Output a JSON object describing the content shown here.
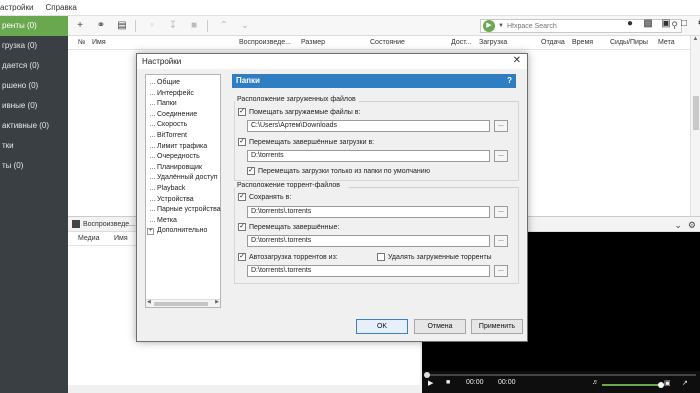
{
  "menubar": {
    "items": [
      "астройки",
      "Справка"
    ]
  },
  "sidebar": {
    "items": [
      {
        "label": "ренты (0)",
        "active": true
      },
      {
        "label": "грузка (0)",
        "active": false
      },
      {
        "label": "дается (0)",
        "active": false
      },
      {
        "label": "ршено (0)",
        "active": false
      },
      {
        "label": "ивные (0)",
        "active": false
      },
      {
        "label": "активные (0)",
        "active": false
      },
      {
        "label": "тки",
        "active": false
      },
      {
        "label": "ты (0)",
        "active": false
      }
    ]
  },
  "toolbar": {
    "search_placeholder": "Hfxpace Search"
  },
  "columns": [
    "№",
    "Имя",
    "Воспроизведе...",
    "Размер",
    "Состояние",
    "Дост...",
    "Загрузка",
    "Отдача",
    "Время",
    "Сиды/Пиры",
    "Мета"
  ],
  "bottom_panel": {
    "tab_label": "Воспроизведе...",
    "columns": [
      "Медиа",
      "Имя"
    ]
  },
  "player": {
    "time_current": "00:00",
    "time_total": "00:00",
    "volume_percent": 95
  },
  "dialog": {
    "title": "Настройки",
    "tree": [
      "Общие",
      "Интерфейс",
      "Папки",
      "Соединение",
      "Скорость",
      "BitTorrent",
      "Лимит трафика",
      "Очередность",
      "Планировщик",
      "Удалённый доступ",
      "Playback",
      "Устройства",
      "Парные устройства",
      "Метка",
      "Дополнительно"
    ],
    "panel_title": "Папки",
    "help": "?",
    "group_downloads": {
      "label": "Расположение загруженных файлов",
      "put_label": "Помещать загружаемые файлы в:",
      "put_value": "C:\\Users\\Артем\\Downloads",
      "move_label": "Перемещать завершённые загрузки в:",
      "move_value": "D:\\torrents",
      "only_default_label": "Перемещать загрузки только из папки по умолчанию"
    },
    "group_torrents": {
      "label": "Расположение торрент-файлов",
      "save_label": "Сохранять в:",
      "save_value": "D:\\torrents\\.torrents",
      "move_done_label": "Перемещать завершённые:",
      "move_done_value": "D:\\torrents\\.torrents",
      "autoload_label": "Автозагрузка торрентов из:",
      "delete_label": "Удалять загруженные торренты",
      "autoload_value": "D:\\torrents\\.torrents"
    },
    "browse_label": "...",
    "buttons": {
      "ok": "OK",
      "cancel": "Отмена",
      "apply": "Применить"
    }
  }
}
